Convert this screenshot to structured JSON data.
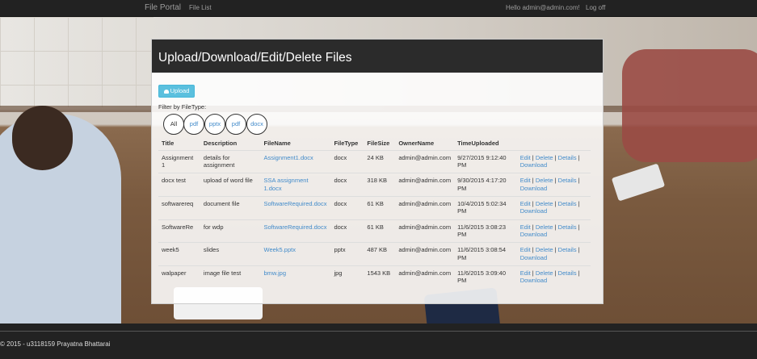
{
  "navbar": {
    "brand": "File Portal",
    "file_list": "File List",
    "hello": "Hello admin@admin.com!",
    "logoff": "Log off"
  },
  "panel": {
    "title": "Upload/Download/Edit/Delete Files"
  },
  "upload_button": {
    "label": "Upload",
    "icon": "cloud-upload-icon"
  },
  "filter": {
    "label": "Filter by FileType:",
    "options": [
      "All",
      "pdf",
      "pptx",
      "pdf",
      "docx"
    ]
  },
  "table": {
    "headers": [
      "Title",
      "Description",
      "FileName",
      "FileType",
      "FileSize",
      "OwnerName",
      "TimeUploaded",
      ""
    ],
    "rows": [
      {
        "title": "Assignment 1",
        "description": "details for assignment",
        "filename": "Assignment1.docx",
        "filetype": "docx",
        "filesize": "24 KB",
        "owner": "admin@admin.com",
        "time": "9/27/2015 9:12:40 PM"
      },
      {
        "title": "docx test",
        "description": "upload of word file",
        "filename": "SSA assignment 1.docx",
        "filetype": "docx",
        "filesize": "318 KB",
        "owner": "admin@admin.com",
        "time": "9/30/2015 4:17:20 PM"
      },
      {
        "title": "softwarereq",
        "description": "document file",
        "filename": "SoftwareRequired.docx",
        "filetype": "docx",
        "filesize": "61 KB",
        "owner": "admin@admin.com",
        "time": "10/4/2015 5:02:34 PM"
      },
      {
        "title": "SoftwareRe",
        "description": "for wdp",
        "filename": "SoftwareRequired.docx",
        "filetype": "docx",
        "filesize": "61 KB",
        "owner": "admin@admin.com",
        "time": "11/6/2015 3:08:23 PM"
      },
      {
        "title": "week5",
        "description": "slides",
        "filename": "Week5.pptx",
        "filetype": "pptx",
        "filesize": "487 KB",
        "owner": "admin@admin.com",
        "time": "11/6/2015 3:08:54 PM"
      },
      {
        "title": "walpaper",
        "description": "image file test",
        "filename": "bmw.jpg",
        "filetype": "jpg",
        "filesize": "1543 KB",
        "owner": "admin@admin.com",
        "time": "11/6/2015 3:09:40 PM"
      }
    ],
    "actions": {
      "edit": "Edit",
      "delete": "Delete",
      "details": "Details",
      "download": "Download",
      "separator": "|"
    }
  },
  "footer": {
    "text": "© 2015 - u3118159 Prayatna Bhattarai"
  }
}
